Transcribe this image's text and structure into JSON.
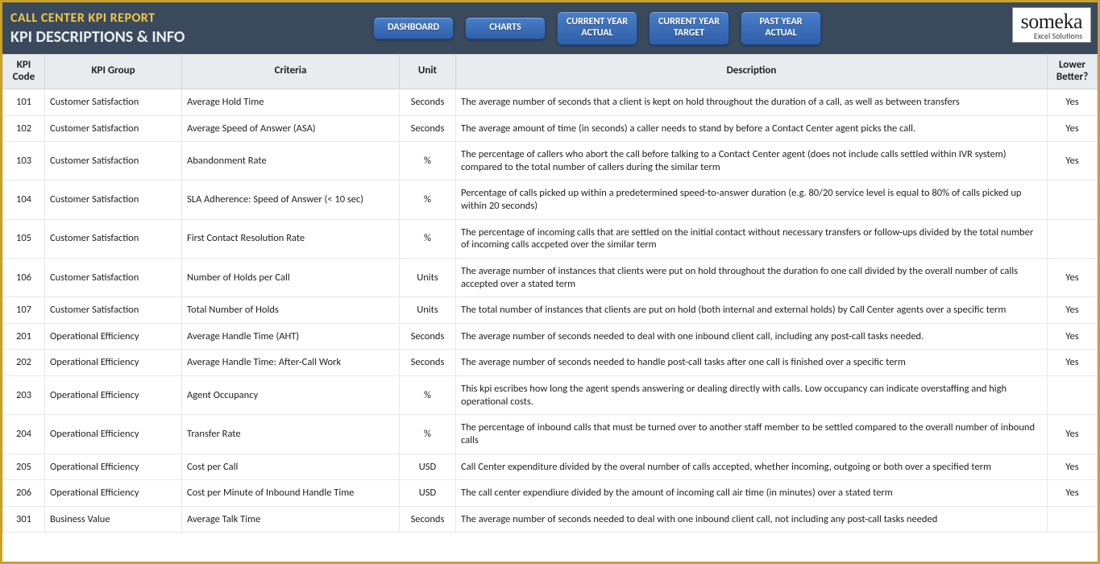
{
  "header": {
    "title_main": "CALL CENTER KPI REPORT",
    "title_sub": "KPI DESCRIPTIONS & INFO",
    "nav": {
      "dashboard": "DASHBOARD",
      "charts": "CHARTS",
      "cur_year_actual": "CURRENT YEAR\nACTUAL",
      "cur_year_target": "CURRENT YEAR\nTARGET",
      "past_year_actual": "PAST YEAR\nACTUAL"
    },
    "logo": {
      "brand": "someka",
      "sub": "Excel Solutions"
    }
  },
  "table": {
    "headers": {
      "code": "KPI\nCode",
      "group": "KPI Group",
      "criteria": "Criteria",
      "unit": "Unit",
      "description": "Description",
      "lower": "Lower\nBetter?"
    },
    "rows": [
      {
        "code": "101",
        "group": "Customer Satisfaction",
        "criteria": "Average Hold Time",
        "unit": "Seconds",
        "desc": "The average number of seconds that a client is kept on hold throughout the duration of a call, as well as between transfers",
        "lower": "Yes"
      },
      {
        "code": "102",
        "group": "Customer Satisfaction",
        "criteria": "Average Speed of Answer (ASA)",
        "unit": "Seconds",
        "desc": "The average amount of time (in seconds) a caller needs to stand by before a Contact Center agent picks the call.",
        "lower": "Yes"
      },
      {
        "code": "103",
        "group": "Customer Satisfaction",
        "criteria": "Abandonment Rate",
        "unit": "%",
        "desc": "The percentage of callers who abort the call before talking to a Contact Center agent (does not include calls settled within IVR system) compared to the total number of callers during the similar term",
        "lower": "Yes"
      },
      {
        "code": "104",
        "group": "Customer Satisfaction",
        "criteria": "SLA Adherence: Speed of Answer (< 10 sec)",
        "unit": "%",
        "desc": "Percentage of calls picked up within a predetermined speed-to-answer duration (e.g. 80/20 service level is equal to 80% of calls picked up within 20 seconds)",
        "lower": ""
      },
      {
        "code": "105",
        "group": "Customer Satisfaction",
        "criteria": "First Contact Resolution Rate",
        "unit": "%",
        "desc": "The percentage of incoming calls that are settled on the initial contact without necessary transfers or follow-ups divided by the total number of incoming calls accpeted over the similar term",
        "lower": ""
      },
      {
        "code": "106",
        "group": "Customer Satisfaction",
        "criteria": "Number of Holds per Call",
        "unit": "Units",
        "desc": "The average number of instances that clients were put on hold throughout the duration fo one call divided by the overall number of calls accepted over a stated term",
        "lower": "Yes"
      },
      {
        "code": "107",
        "group": "Customer Satisfaction",
        "criteria": "Total Number of Holds",
        "unit": "Units",
        "desc": "The total number of instances that clients are put on hold (both internal and external holds) by Call Center agents over a specific term",
        "lower": "Yes"
      },
      {
        "code": "201",
        "group": "Operational Efficiency",
        "criteria": "Average Handle Time (AHT)",
        "unit": "Seconds",
        "desc": "The average number of seconds needed to deal with one inbound client call, including any post-call tasks needed.",
        "lower": "Yes"
      },
      {
        "code": "202",
        "group": "Operational Efficiency",
        "criteria": "Average Handle Time: After-Call Work",
        "unit": "Seconds",
        "desc": "The average number of seconds needed to handle post-call tasks after one call is finished over a specific term",
        "lower": "Yes"
      },
      {
        "code": "203",
        "group": "Operational Efficiency",
        "criteria": "Agent Occupancy",
        "unit": "%",
        "desc": "This kpi escribes how long the agent spends answering or dealing directly with calls. Low occupancy can indicate overstaffing and high operational costs.",
        "lower": ""
      },
      {
        "code": "204",
        "group": "Operational Efficiency",
        "criteria": "Transfer Rate",
        "unit": "%",
        "desc": "The percentage of inbound calls that must be turned over to another staff member to be settled compared to the overall number of inbound calls",
        "lower": "Yes"
      },
      {
        "code": "205",
        "group": "Operational Efficiency",
        "criteria": "Cost per Call",
        "unit": "USD",
        "desc": "Call Center expenditure divided by the overal number of calls accepted, whether incoming, outgoing or both over a specified term",
        "lower": "Yes"
      },
      {
        "code": "206",
        "group": "Operational Efficiency",
        "criteria": "Cost per Minute of Inbound Handle Time",
        "unit": "USD",
        "desc": "The call center expendiure divided by the amount of incoming call air time (in minutes) over a stated term",
        "lower": "Yes"
      },
      {
        "code": "301",
        "group": "Business Value",
        "criteria": "Average Talk Time",
        "unit": "Seconds",
        "desc": "The average number of seconds needed to deal with one inbound client call, not including any post-call tasks needed",
        "lower": ""
      }
    ]
  }
}
